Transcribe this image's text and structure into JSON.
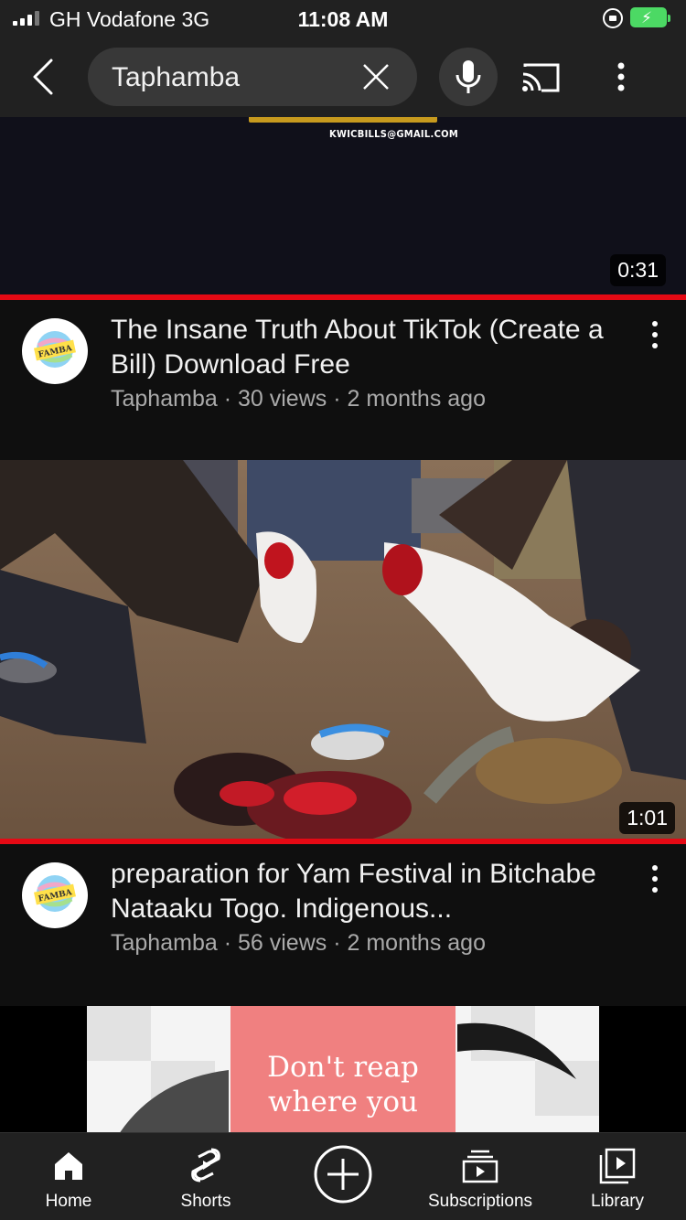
{
  "status_bar": {
    "carrier": "GH Vodafone  3G",
    "time": "11:08 AM"
  },
  "search": {
    "query": "Taphamba"
  },
  "feed": {
    "partial_video": {
      "thumbnail_email_text": "KWICBILLS@GMAIL.COM",
      "duration": "0:31",
      "title": "The Insane Truth About TikTok (Create a Bill) Download Free",
      "channel": "Taphamba",
      "views": "30 views",
      "age": "2 months ago",
      "watched_progress": 1.0
    },
    "video_2": {
      "duration": "1:01",
      "title": "preparation for Yam Festival in Bitchabe Nataaku Togo. Indigenous...",
      "channel": "Taphamba",
      "views": "56 views",
      "age": "2 months ago",
      "watched_progress": 1.0
    },
    "video_3": {
      "thumbnail_text": "Don't reap where you"
    },
    "avatar_text": "FAMBA",
    "separator": "·"
  },
  "bottom_nav": {
    "items": [
      {
        "label": "Home",
        "icon": "home-icon"
      },
      {
        "label": "Shorts",
        "icon": "shorts-icon"
      },
      {
        "label": "",
        "icon": "create-icon"
      },
      {
        "label": "Subscriptions",
        "icon": "subscriptions-icon"
      },
      {
        "label": "Library",
        "icon": "library-icon"
      }
    ]
  },
  "colors": {
    "accent_red": "#e50914",
    "background": "#0f0f0f",
    "bar": "#212121",
    "battery_green": "#4cd964"
  }
}
